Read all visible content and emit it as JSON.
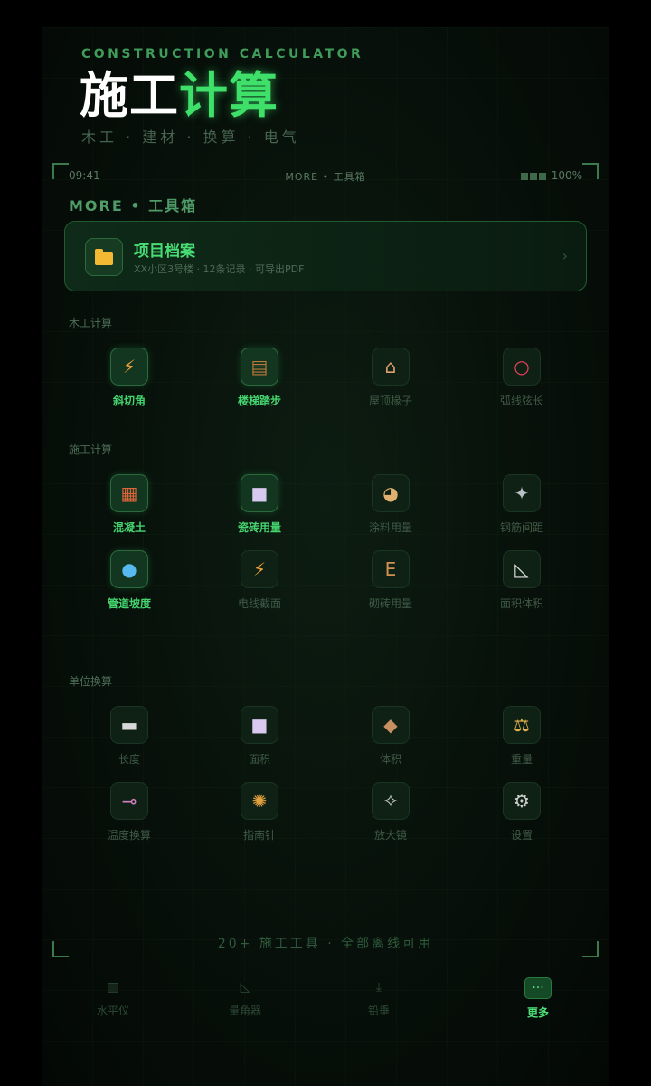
{
  "brand": {
    "subtitle": "CONSTRUCTION CALCULATOR",
    "title_white": "施工",
    "title_green": "计算",
    "tags": "木工 · 建材 · 换算 · 电气"
  },
  "status": {
    "time": "09:41",
    "center": "MORE • 工具箱",
    "battery": "100%"
  },
  "heading": "MORE • 工具箱",
  "project": {
    "title": "项目档案",
    "desc": "XX小区3号楼 · 12条记录 · 可导出PDF",
    "chevron": "›",
    "icon": "folder-icon"
  },
  "groups": [
    {
      "label": "木工计算",
      "items": [
        {
          "label": "斜切角",
          "glyph": "⚡",
          "icon": "lightning-icon",
          "highlight": true,
          "color": "#f0a23a"
        },
        {
          "label": "楼梯踏步",
          "glyph": "▤",
          "icon": "ladder-icon",
          "highlight": true,
          "color": "#c0783a"
        },
        {
          "label": "屋顶椽子",
          "glyph": "⌂",
          "icon": "house-icon",
          "highlight": false,
          "color": "#e0a070"
        },
        {
          "label": "弧线弦长",
          "glyph": "○",
          "icon": "circle-icon",
          "highlight": false,
          "color": "#f04060"
        }
      ]
    },
    {
      "label": "施工计算",
      "items": [
        {
          "label": "混凝土",
          "glyph": "▦",
          "icon": "brick-icon",
          "highlight": true,
          "color": "#e0663c"
        },
        {
          "label": "瓷砖用量",
          "glyph": "■",
          "icon": "tile-icon",
          "highlight": true,
          "color": "#d9c8f0"
        },
        {
          "label": "涂料用量",
          "glyph": "◕",
          "icon": "palette-icon",
          "highlight": false,
          "color": "#e0b070"
        },
        {
          "label": "钢筋间距",
          "glyph": "✦",
          "icon": "rebar-icon",
          "highlight": false,
          "color": "#b8c0c8"
        },
        {
          "label": "管道坡度",
          "glyph": "●",
          "icon": "droplet-icon",
          "highlight": true,
          "color": "#58b8f0"
        },
        {
          "label": "电线截面",
          "glyph": "⚡",
          "icon": "lightning-icon",
          "highlight": false,
          "color": "#f0a23a"
        },
        {
          "label": "砌砖用量",
          "glyph": "E",
          "icon": "brick-wall-icon",
          "highlight": false,
          "color": "#d09050"
        },
        {
          "label": "面积体积",
          "glyph": "◺",
          "icon": "triangle-ruler-icon",
          "highlight": false,
          "color": "#e0e0e0"
        }
      ]
    },
    {
      "label": "单位换算",
      "items": [
        {
          "label": "长度",
          "glyph": "▬",
          "icon": "ruler-icon",
          "highlight": false,
          "color": "#d8d8d8"
        },
        {
          "label": "面积",
          "glyph": "■",
          "icon": "square-icon",
          "highlight": false,
          "color": "#d9c8f0"
        },
        {
          "label": "体积",
          "glyph": "◆",
          "icon": "box-icon",
          "highlight": false,
          "color": "#c89060"
        },
        {
          "label": "重量",
          "glyph": "⚖",
          "icon": "scale-icon",
          "highlight": false,
          "color": "#e0b050"
        },
        {
          "label": "温度换算",
          "glyph": "⊸",
          "icon": "thermometer-icon",
          "highlight": false,
          "color": "#d080c0"
        },
        {
          "label": "指南针",
          "glyph": "✺",
          "icon": "compass-icon",
          "highlight": false,
          "color": "#e0a040"
        },
        {
          "label": "放大镜",
          "glyph": "✧",
          "icon": "flashlight-icon",
          "highlight": false,
          "color": "#c8c8c8"
        },
        {
          "label": "设置",
          "glyph": "⚙",
          "icon": "gear-icon",
          "highlight": false,
          "color": "#d0d0d0"
        }
      ]
    }
  ],
  "footer": "20+ 施工工具 · 全部离线可用",
  "tabs": [
    {
      "label": "水平仪",
      "glyph": "▥",
      "icon": "level-icon",
      "active": false
    },
    {
      "label": "量角器",
      "glyph": "◺",
      "icon": "protractor-icon",
      "active": false
    },
    {
      "label": "铅垂",
      "glyph": "⤓",
      "icon": "plumb-icon",
      "active": false
    },
    {
      "label": "更多",
      "glyph": "···",
      "icon": "more-icon",
      "active": true
    }
  ]
}
